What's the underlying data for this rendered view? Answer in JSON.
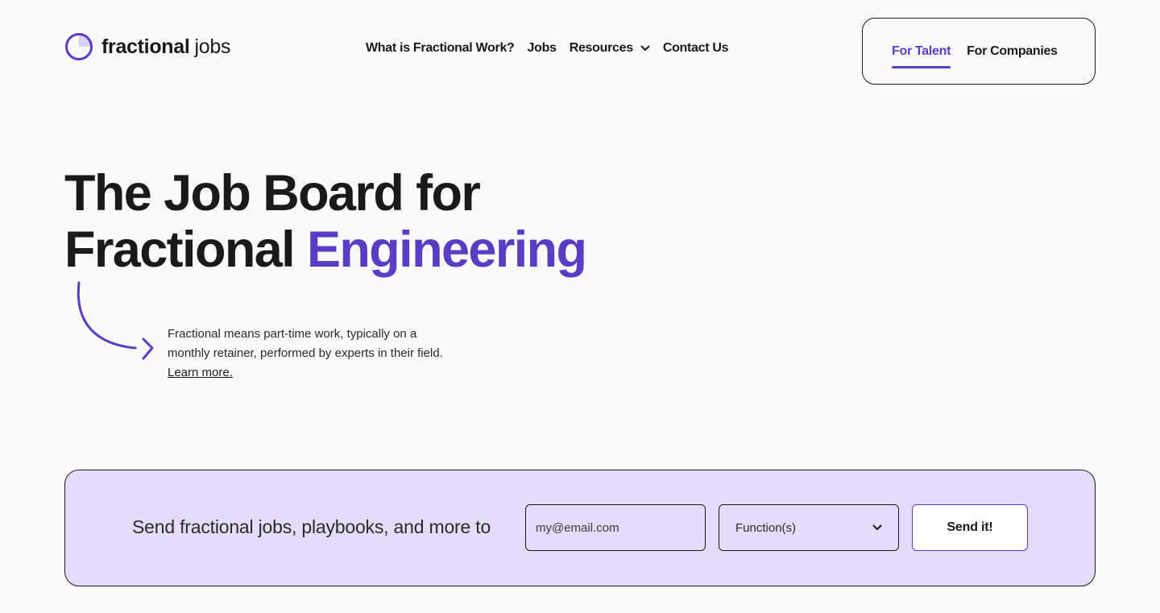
{
  "brand": {
    "name_bold": "fractional",
    "name_light": "jobs",
    "accent_color": "#5b3cc4",
    "light_accent_color": "#e4dcfb",
    "icon": "circle-logo-icon"
  },
  "nav": {
    "items": [
      {
        "label": "What is Fractional Work?"
      },
      {
        "label": "Jobs"
      },
      {
        "label": "Resources",
        "icon": "chevron-down-icon"
      },
      {
        "label": "Contact Us"
      }
    ]
  },
  "audience": {
    "tabs": [
      {
        "label": "For Talent",
        "active": true
      },
      {
        "label": "For Companies",
        "active": false
      }
    ]
  },
  "hero": {
    "title_line1": "The Job Board for",
    "title_line2_plain": "Fractional",
    "title_line2_accent": "Engineering",
    "description": "Fractional means part-time work, typically on a monthly retainer, performed by experts in their field.",
    "learn_more": "Learn more."
  },
  "signup": {
    "text": "Send fractional jobs, playbooks, and more to",
    "email_placeholder": "my@email.com",
    "email_value": "",
    "function_placeholder": "Function(s)",
    "submit_label": "Send it!"
  }
}
